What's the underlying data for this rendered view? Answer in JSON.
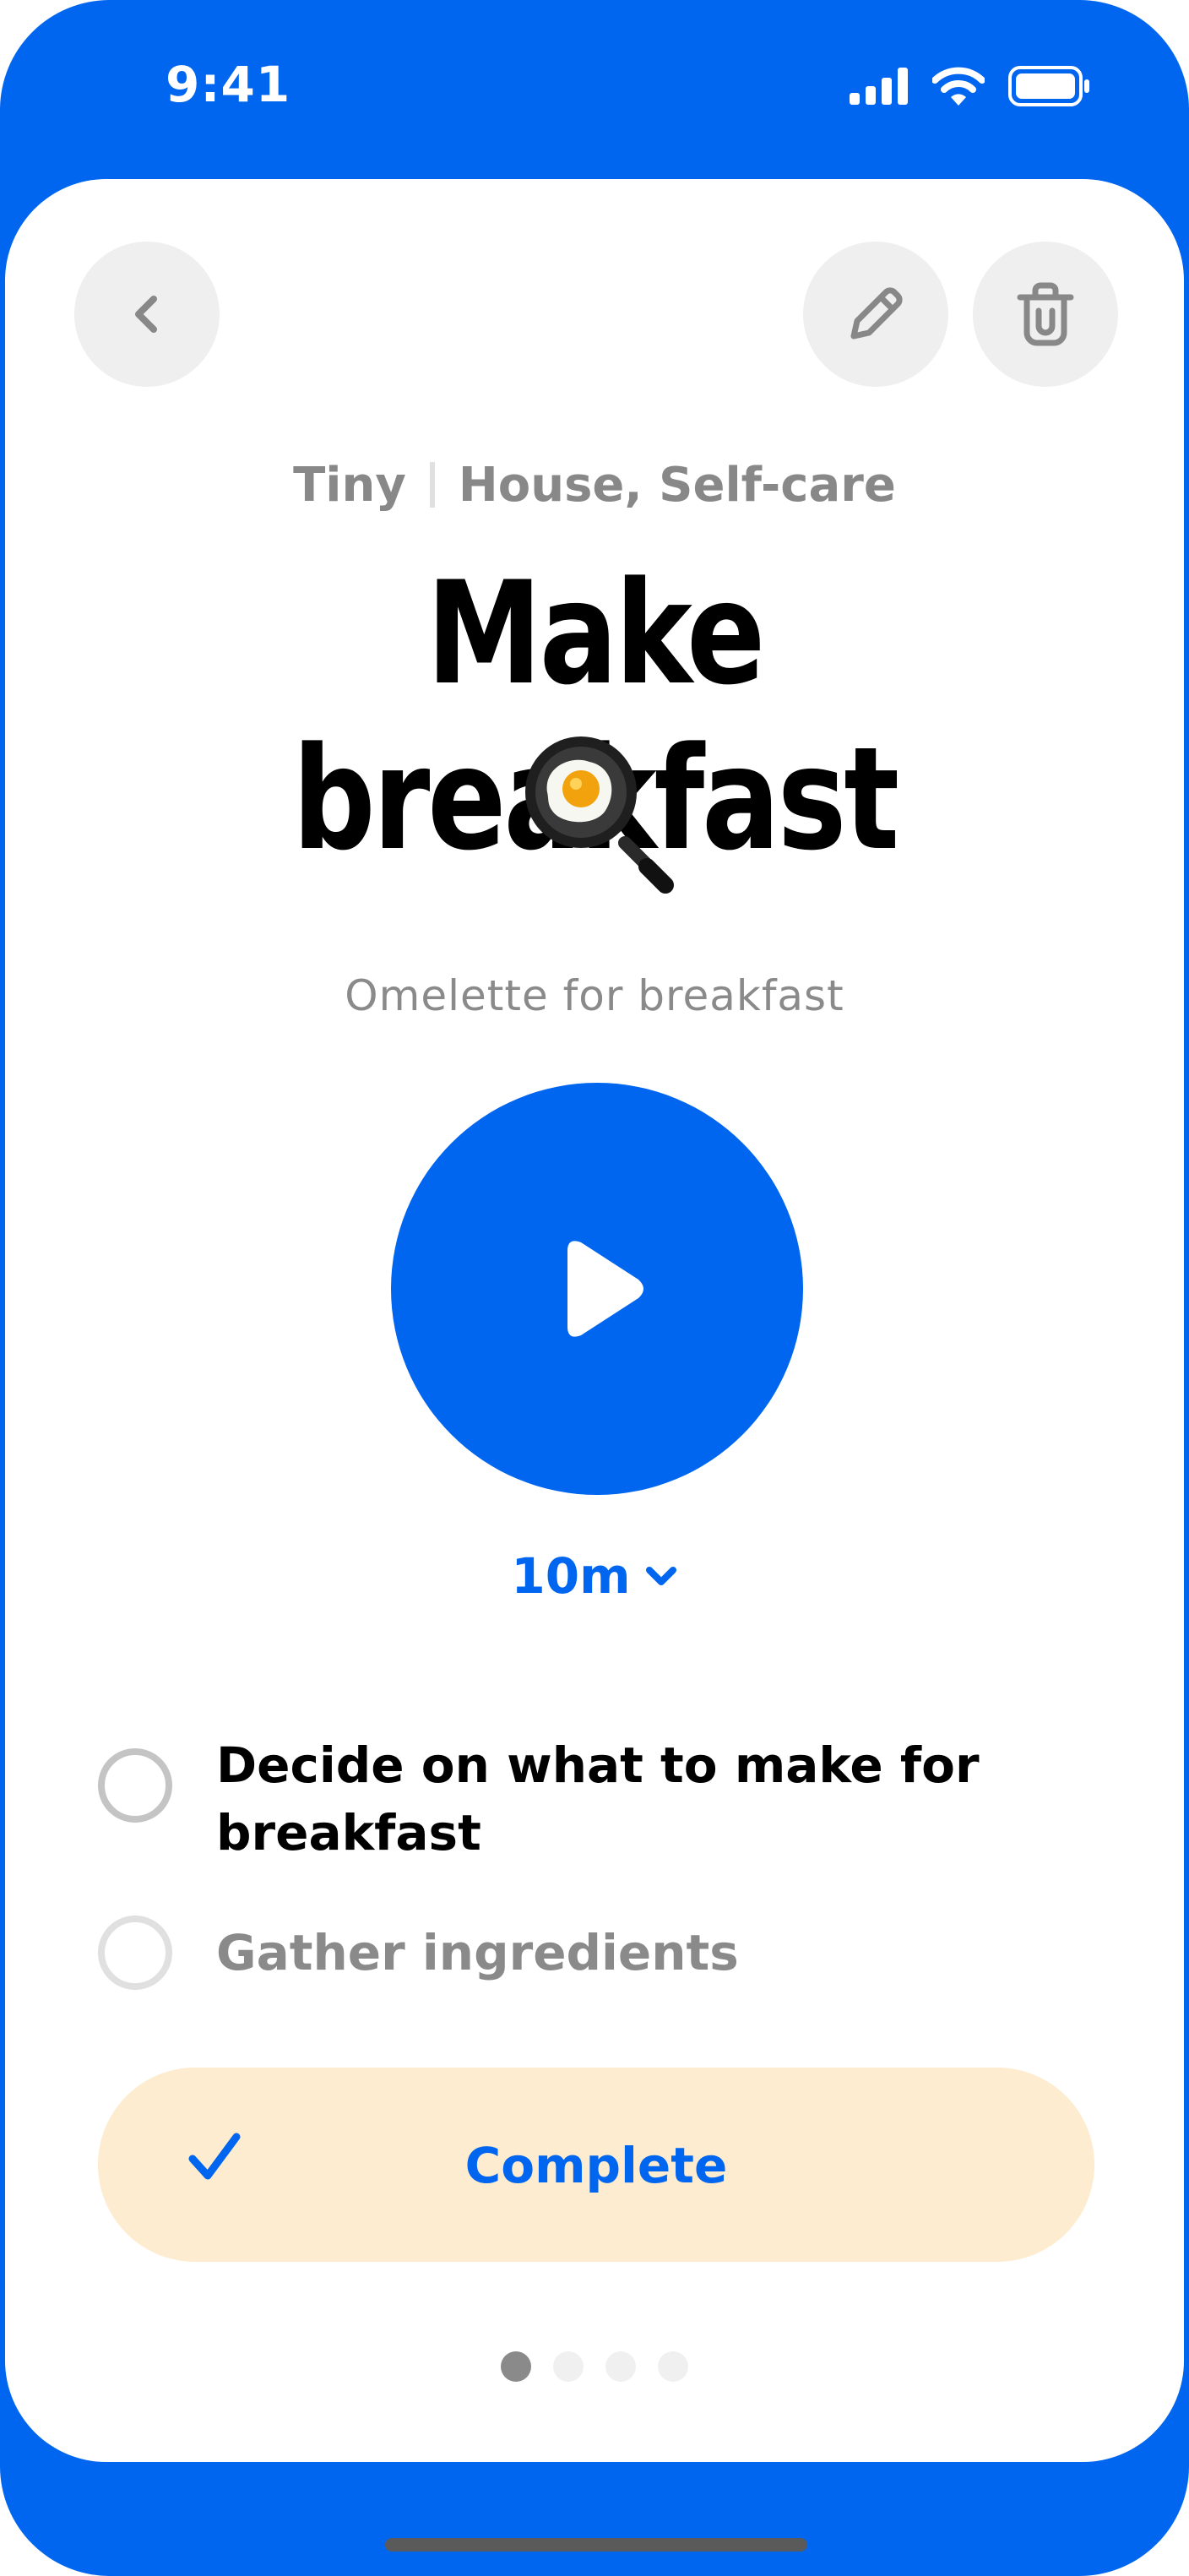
{
  "status_bar": {
    "time": "9:41"
  },
  "header": {
    "back_icon": "chevron-left-icon",
    "edit_icon": "pencil-icon",
    "delete_icon": "trash-icon"
  },
  "task": {
    "size": "Tiny",
    "categories": "House, Self-care",
    "title": "Make breakfast",
    "emoji": "frying-pan-egg-icon",
    "description": "Omelette for breakfast",
    "duration": "10m"
  },
  "steps": [
    {
      "label": "Decide on what to make for breakfast",
      "checked": false
    },
    {
      "label": "Gather ingredients",
      "checked": false
    }
  ],
  "actions": {
    "complete_label": "Complete"
  },
  "pagination": {
    "total": 4,
    "current": 1
  },
  "colors": {
    "accent": "#0066f0",
    "complete_bg": "#fdeccf",
    "muted": "#8a8a8a"
  }
}
